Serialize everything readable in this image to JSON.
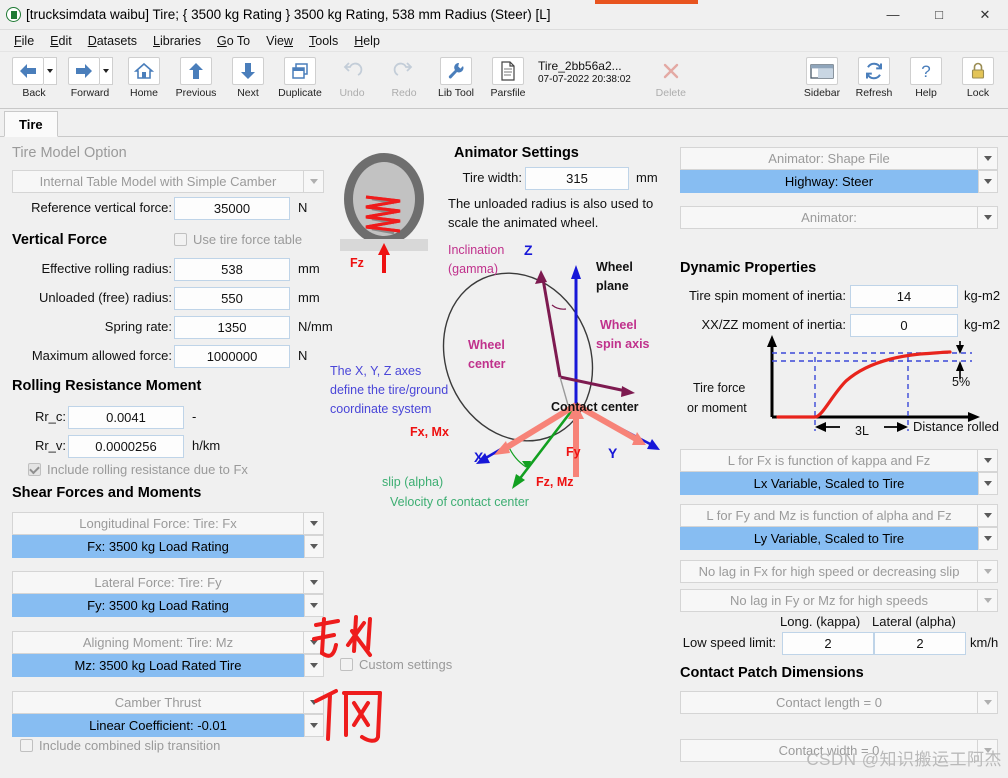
{
  "window": {
    "title": "[trucksimdata  waibu] Tire; { 3500 kg Rating } 3500 kg Rating, 538 mm Radius (Steer) [L]",
    "app_icon": "app-icon",
    "minimize": "—",
    "maximize": "□",
    "close": "✕",
    "accent_color": "#e8541f"
  },
  "menubar": [
    {
      "label": "File"
    },
    {
      "label": "Edit"
    },
    {
      "label": "Datasets"
    },
    {
      "label": "Libraries"
    },
    {
      "label": "Go To"
    },
    {
      "label": "View"
    },
    {
      "label": "Tools"
    },
    {
      "label": "Help"
    }
  ],
  "toolbar": {
    "left": [
      {
        "label": "Back",
        "icon": "arrow-left-icon",
        "dropdown": true,
        "disabled": false
      },
      {
        "label": "Forward",
        "icon": "arrow-right-icon",
        "dropdown": true,
        "disabled": false
      },
      {
        "label": "Home",
        "icon": "home-icon",
        "dropdown": false,
        "disabled": false
      },
      {
        "label": "Previous",
        "icon": "arrow-up-icon",
        "dropdown": false,
        "disabled": false
      },
      {
        "label": "Next",
        "icon": "arrow-down-icon",
        "dropdown": false,
        "disabled": false
      },
      {
        "label": "Duplicate",
        "icon": "duplicate-icon",
        "dropdown": false,
        "disabled": false
      },
      {
        "label": "Undo",
        "icon": "undo-icon",
        "dropdown": false,
        "disabled": true
      },
      {
        "label": "Redo",
        "icon": "redo-icon",
        "dropdown": false,
        "disabled": true
      },
      {
        "label": "Lib Tool",
        "icon": "wrench-icon",
        "dropdown": false,
        "disabled": false
      },
      {
        "label": "Parsfile",
        "icon": "document-icon",
        "dropdown": false,
        "disabled": false
      }
    ],
    "parsfile_name": "Tire_2bb56a2...",
    "parsfile_date": "07-07-2022 20:38:02",
    "delete": {
      "label": "Delete",
      "icon": "close-x-icon",
      "disabled": true
    },
    "right": [
      {
        "label": "Sidebar",
        "icon": "sidebar-icon"
      },
      {
        "label": "Refresh",
        "icon": "refresh-icon"
      },
      {
        "label": "Help",
        "icon": "question-mark-icon"
      },
      {
        "label": "Lock",
        "icon": "lock-icon"
      }
    ]
  },
  "tabs": [
    {
      "label": "Tire",
      "active": true
    }
  ],
  "left_panel": {
    "tire_model_option": {
      "heading": "Tire Model Option",
      "model_dropdown": "Internal Table Model with Simple Camber",
      "reference_vertical_force": {
        "label": "Reference vertical force:",
        "value": "35000",
        "unit": "N"
      }
    },
    "vertical_force": {
      "heading": "Vertical Force",
      "use_tire_force_table": {
        "label": "Use tire force table",
        "checked": false
      },
      "fields": [
        {
          "label": "Effective rolling radius:",
          "value": "538",
          "unit": "mm"
        },
        {
          "label": "Unloaded (free) radius:",
          "value": "550",
          "unit": "mm"
        },
        {
          "label": "Spring rate:",
          "value": "1350",
          "unit": "N/mm"
        },
        {
          "label": "Maximum allowed force:",
          "value": "1000000",
          "unit": "N"
        }
      ]
    },
    "rolling_resistance": {
      "heading": "Rolling Resistance Moment",
      "fields": [
        {
          "label": "Rr_c:",
          "value": "0.0041",
          "unit": "-"
        },
        {
          "label": "Rr_v:",
          "value": "0.0000256",
          "unit": "h/km"
        }
      ],
      "include_rr_fx": {
        "label": "Include rolling resistance due to Fx",
        "checked": true
      }
    },
    "shear_forces": {
      "heading": "Shear Forces and Moments",
      "groups": [
        {
          "title": "Longitudinal Force: Tire: Fx",
          "selected": "Fx: 3500 kg Load Rating"
        },
        {
          "title": "Lateral Force: Tire: Fy",
          "selected": "Fy: 3500 kg Load Rating"
        },
        {
          "title": "Aligning Moment: Tire: Mz",
          "selected": "Mz: 3500 kg Load Rated Tire"
        },
        {
          "title": "Camber Thrust",
          "selected": "Linear Coefficient: -0.01"
        }
      ],
      "include_combined_slip": {
        "label": "Include combined slip transition",
        "checked": false
      }
    }
  },
  "center_panel": {
    "tire_graphic": {
      "name": "tire-spring-graphic",
      "force_label": "Fz"
    },
    "animator_settings": {
      "heading": "Animator Settings",
      "tire_width": {
        "label": "Tire width:",
        "value": "315",
        "unit": "mm"
      },
      "note_line1": "The unloaded radius is also used to",
      "note_line2": "scale the animated wheel."
    },
    "axes_note": {
      "line1": "The X, Y, Z axes",
      "line2": "define the tire/ground",
      "line3": "coordinate system"
    },
    "custom_settings": {
      "label": "Custom settings",
      "checked": false
    },
    "diagram_labels": {
      "inclination_l1": "Inclination",
      "inclination_l2": "(gamma)",
      "z_axis": "Z",
      "x_axis": "X",
      "y_axis": "Y",
      "wheel_plane_l1": "Wheel",
      "wheel_plane_l2": "plane",
      "wheel_spin_l1": "Wheel",
      "wheel_spin_l2": "spin axis",
      "wheel_center_l1": "Wheel",
      "wheel_center_l2": "center",
      "contact_center": "Contact center",
      "fx_mx": "Fx, Mx",
      "fy": "Fy",
      "fz_mz": "Fz, Mz",
      "slip_alpha": "slip (alpha)",
      "velocity": "Velocity of contact center"
    },
    "annotations": [
      {
        "text": "纵从",
        "color": "#ee1c1c"
      },
      {
        "text": "侧",
        "color": "#ee1c1c"
      }
    ]
  },
  "right_panel": {
    "animator": {
      "shape_file_title": "Animator: Shape File",
      "shape_file_selected": "Highway: Steer",
      "animator_empty": "Animator:"
    },
    "dynamic_properties": {
      "heading": "Dynamic Properties",
      "fields": [
        {
          "label": "Tire spin moment of inertia:",
          "value": "14",
          "unit": "kg-m2"
        },
        {
          "label": "XX/ZZ moment of inertia:",
          "value": "0",
          "unit": "kg-m2"
        }
      ]
    },
    "relaxation_dropdowns": [
      {
        "title": "L for Fx is function of kappa and Fz",
        "selected": "Lx Variable, Scaled to Tire"
      },
      {
        "title": "L for Fy and Mz is function of alpha and Fz",
        "selected": "Ly Variable, Scaled to Tire"
      }
    ],
    "lag_dropdowns": [
      {
        "label": "No lag in Fx for high speed or decreasing slip"
      },
      {
        "label": "No lag in Fy or Mz for high speeds"
      }
    ],
    "low_speed": {
      "col1_header": "Long. (kappa)",
      "col2_header": "Lateral (alpha)",
      "label": "Low speed limit:",
      "value1": "2",
      "value2": "2",
      "unit": "km/h"
    },
    "contact_patch": {
      "heading": "Contact Patch Dimensions",
      "length_dropdown": "Contact length = 0",
      "width_dropdown": "Contact width = 0"
    }
  },
  "chart_data": {
    "type": "line",
    "title": "",
    "ylabel_line1": "Tire force",
    "ylabel_line2": "or moment",
    "xlabel": "Distance rolled",
    "annotation_3L": "3L",
    "annotation_5pct": "5%",
    "xlim": [
      0,
      10
    ],
    "ylim": [
      0,
      1.1
    ],
    "x": [
      0,
      1.2,
      2.0,
      2.0,
      2.3,
      2.8,
      3.4,
      4.1,
      5.0,
      6.0,
      7.0,
      8.0,
      8.6
    ],
    "values": [
      0,
      0,
      0,
      0.12,
      0.38,
      0.56,
      0.68,
      0.77,
      0.85,
      0.9,
      0.935,
      0.955,
      0.965
    ],
    "series_color": "#e8241c",
    "guide_color": "#3a49d8",
    "guide_lines_y": [
      0.95,
      1.0
    ],
    "guide_lines_x": [
      2.0,
      5.0
    ],
    "grid": false,
    "legend": null
  },
  "watermark": "CSDN @知识搬运工阿杰"
}
